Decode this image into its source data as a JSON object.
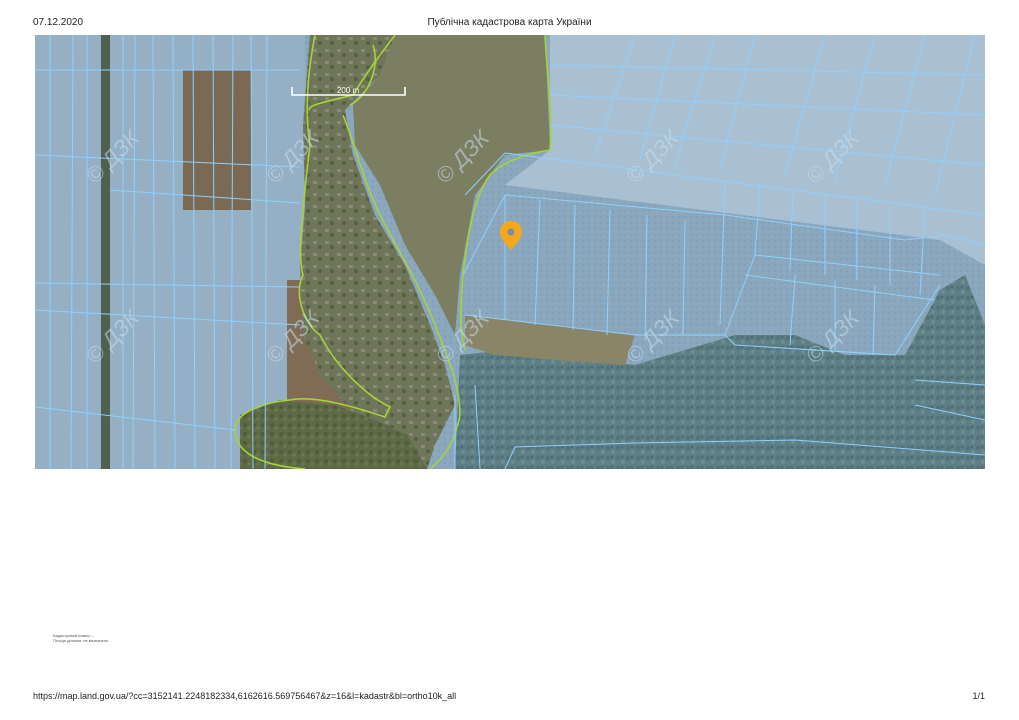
{
  "header": {
    "date": "07.12.2020",
    "title": "Публічна кадастрова карта України"
  },
  "map": {
    "scale_label": "200 m",
    "watermark": "© ДЗК",
    "layers": [
      "kadastr",
      "ortho10k_all"
    ],
    "colors": {
      "parcel_border": "#8fd0ff",
      "forest_border": "#a6d23a",
      "marker": "#f4a81d",
      "cadastral_tint": "#7fa6c6"
    },
    "marker_icon": "location-pin-icon"
  },
  "note": {
    "line1": "Кадастровий номер: –",
    "line2": "Площа ділянки: не визначено"
  },
  "footer": {
    "url": "https://map.land.gov.ua/?cc=3152141.2248182334,6162616.569756467&z=16&l=kadastr&bl=ortho10k_all",
    "page": "1/1"
  }
}
